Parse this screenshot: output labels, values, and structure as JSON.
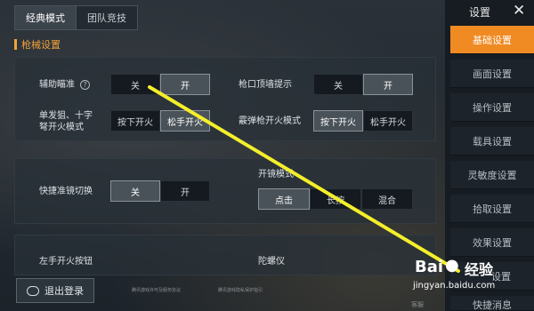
{
  "top_tabs": [
    {
      "label": "经典模式",
      "active": true
    },
    {
      "label": "团队竞技",
      "active": false
    }
  ],
  "sidebar": {
    "title": "设置",
    "close_icon": "✕",
    "items": [
      {
        "label": "基础设置",
        "active": true
      },
      {
        "label": "画面设置",
        "active": false
      },
      {
        "label": "操作设置",
        "active": false
      },
      {
        "label": "载具设置",
        "active": false
      },
      {
        "label": "灵敏度设置",
        "active": false
      },
      {
        "label": "拾取设置",
        "active": false
      },
      {
        "label": "效果设置",
        "active": false
      },
      {
        "label": "设置",
        "active": false
      },
      {
        "label": "快捷消息",
        "active": false
      }
    ]
  },
  "section": {
    "title": "枪械设置"
  },
  "settings": {
    "aim_assist": {
      "label": "辅助瞄准",
      "help": "?",
      "options": [
        "关",
        "开"
      ],
      "selected": 1
    },
    "muzzle_hint": {
      "label": "枪口顶墙提示",
      "options": [
        "关",
        "开"
      ],
      "selected": 1
    },
    "single_fire": {
      "label_line1": "单发狙、十字",
      "label_line2": "弩开火模式",
      "options": [
        "按下开火",
        "松手开火"
      ],
      "selected": 1
    },
    "shotgun_fire": {
      "label": "霰弹枪开火模式",
      "options": [
        "按下开火",
        "松手开火"
      ],
      "selected": 0
    },
    "quick_scope": {
      "label": "快捷准镜切换",
      "options": [
        "关",
        "开"
      ],
      "selected": 0
    },
    "scope_mode": {
      "label": "开镜模式",
      "options": [
        "点击",
        "长按",
        "混合"
      ],
      "selected": 0
    },
    "left_fire": {
      "label": "左手开火按钮"
    },
    "gyroscope": {
      "label": "陀螺仪"
    }
  },
  "footer": {
    "logout_label": "退出登录",
    "text1": "腾讯游戏许可及服务协议",
    "text2": "腾讯游戏隐私保护指引",
    "text3": "客服"
  },
  "watermark": {
    "brand": "Bai",
    "brand2": "经验",
    "url": "jingyan.baidu.com"
  },
  "colors": {
    "accent": "#f08a23",
    "annotation_line": "#f4ef2a"
  }
}
